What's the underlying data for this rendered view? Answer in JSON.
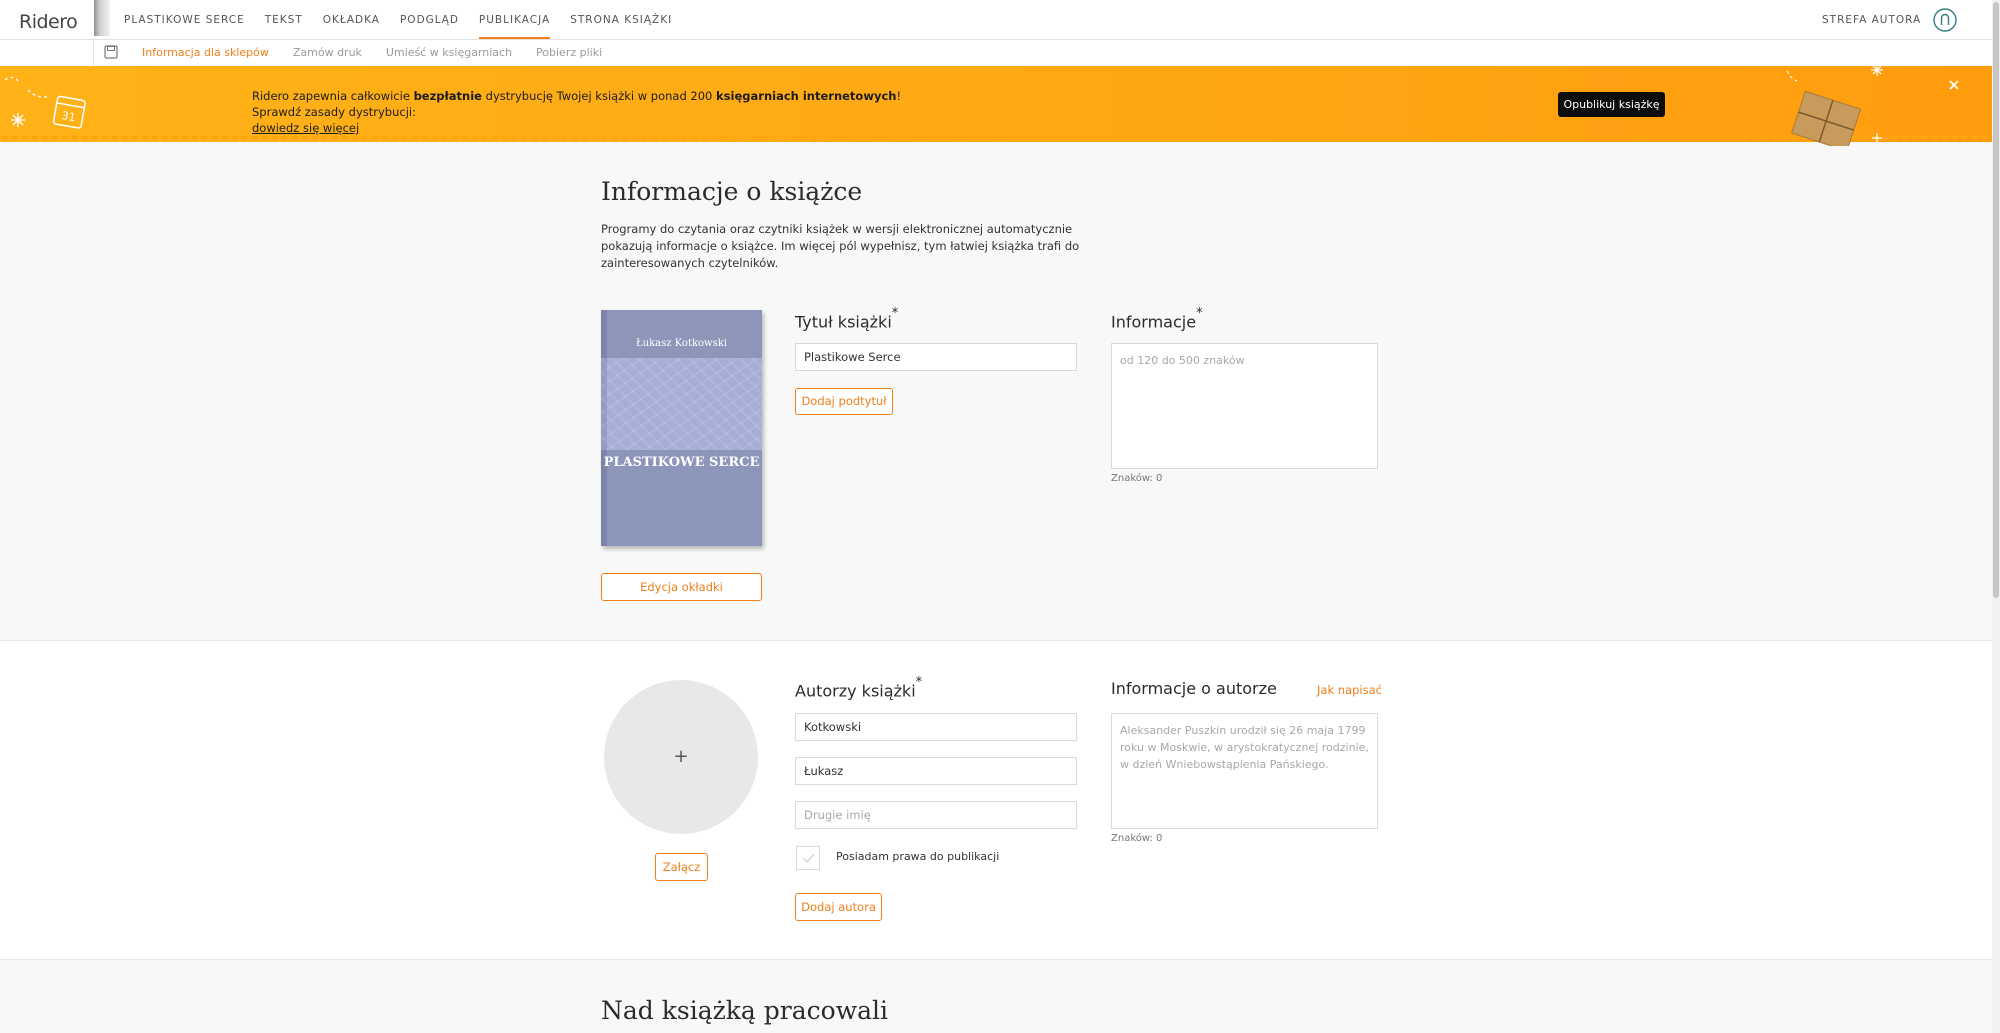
{
  "app": {
    "logo": "Ridero"
  },
  "nav": {
    "items": [
      "Plastikowe Serce",
      "Tekst",
      "Okładka",
      "Podgląd",
      "Publikacja",
      "Strona książki"
    ],
    "active_index": 4,
    "author_zone": "Strefa autora"
  },
  "subnav": {
    "items": [
      "Informacja dla sklepów",
      "Zamów druk",
      "Umieść w księgarniach",
      "Pobierz pliki"
    ],
    "active_index": 0
  },
  "banner": {
    "text_1": "Ridero zapewnia całkowicie ",
    "bold_1": "bezpłatnie",
    "text_2": " dystrybucję Twojej książki w ponad 200 ",
    "bold_2": "księgarniach internetowych",
    "text_3": "! Sprawdź zasady dystrybucji:",
    "link": "dowiedz się więcej",
    "button": "Opublikuj książkę",
    "calendar_day": "31"
  },
  "book_info": {
    "heading": "Informacje o książce",
    "intro": "Programy do czytania oraz czytniki książek w wersji elektronicznej automatycznie pokazują informacje o książce. Im więcej pól wypełnisz, tym łatwiej książka trafi do zainteresowanych czytelników.",
    "cover": {
      "author": "Łukasz Kotkowski",
      "title": "PLASTIKOWE SERCE"
    },
    "edit_cover_button": "Edycja okładki",
    "title_label": "Tytuł książki",
    "required_mark": "*",
    "title_value": "Plastikowe Serce",
    "add_subtitle_button": "Dodaj podtytuł",
    "info_label": "Informacje",
    "info_placeholder": "od 120 do 500 znaków",
    "info_counter": "Znaków: 0"
  },
  "authors": {
    "attach_button": "Załącz",
    "avatar_plus": "+",
    "label": "Autorzy książki",
    "last_name": "Kotkowski",
    "first_name": "Łukasz",
    "middle_name_placeholder": "Drugie imię",
    "rights_label": "Posiadam prawa do publikacji",
    "add_author_button": "Dodaj autora",
    "about_label": "Informacje o autorze",
    "how_to_write": "Jak napisać",
    "about_placeholder": "Aleksander Puszkin urodził się 26 maja 1799 roku w Moskwie, w arystokratycznej rodzinie, w dzień Wniebowstąpienia Pańskiego.",
    "about_counter": "Znaków: 0"
  },
  "contributors": {
    "heading": "Nad książką pracowali"
  },
  "colors": {
    "accent": "#ef7f1a",
    "banner": "#ffab15"
  }
}
